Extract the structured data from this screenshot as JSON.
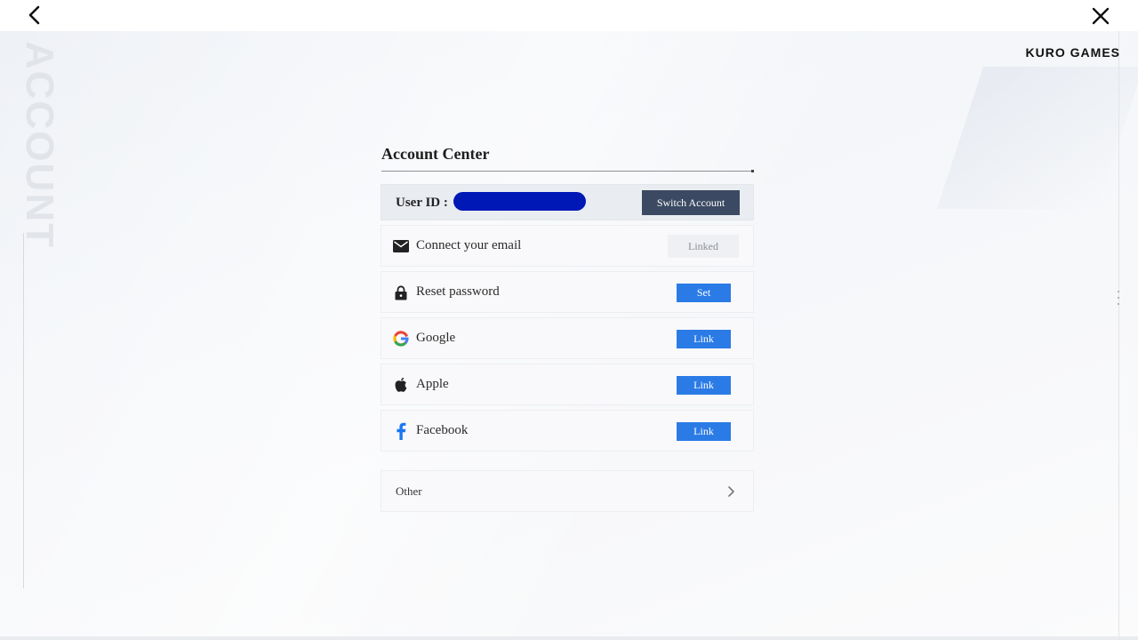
{
  "brand": "KURO GAMES",
  "side_title": "ACCOUNT",
  "panel": {
    "title": "Account Center",
    "user_id_label": "User ID :",
    "switch_account": "Switch Account",
    "rows": [
      {
        "icon": "mail-icon",
        "label": "Connect your email",
        "action": "Linked"
      },
      {
        "icon": "lock-icon",
        "label": "Reset password",
        "action": "Set"
      },
      {
        "icon": "google-icon",
        "label": "Google",
        "action": "Link"
      },
      {
        "icon": "apple-icon",
        "label": "Apple",
        "action": "Link"
      },
      {
        "icon": "facebook-icon",
        "label": "Facebook",
        "action": "Link"
      }
    ],
    "other_label": "Other"
  },
  "colors": {
    "primary_button": "#2b7be6",
    "switch_button": "#3b4a62",
    "user_id_mask": "#0018b5"
  }
}
